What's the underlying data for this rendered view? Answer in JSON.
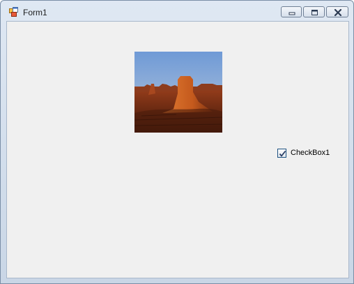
{
  "window": {
    "title": "Form1"
  },
  "titlebar": {
    "buttons": [
      "minimize",
      "maximize",
      "close"
    ]
  },
  "form": {
    "picture": {
      "description_icon": "desert-landscape-image"
    },
    "checkbox": {
      "label": "CheckBox1",
      "checked": true
    }
  },
  "colors": {
    "client_background": "#f0f0f0",
    "titlebar": "#d5e0ee"
  }
}
